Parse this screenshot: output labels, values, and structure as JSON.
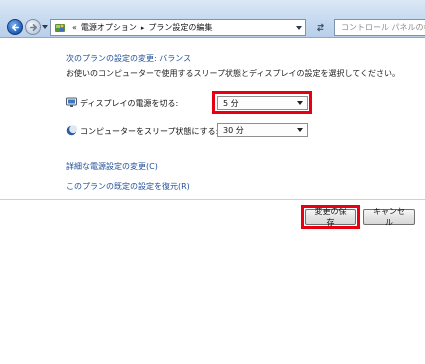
{
  "nav": {
    "breadcrumb_separator": "«",
    "crumbs": [
      "電源オプション",
      "プラン設定の編集"
    ],
    "crumb_arrow": "▸",
    "search_placeholder": "コントロール パネルの検索"
  },
  "content": {
    "heading": "次のプランの設定の変更: バランス",
    "description": "お使いのコンピューターで使用するスリープ状態とディスプレイの設定を選択してください。",
    "display_off": {
      "label": "ディスプレイの電源を切る:",
      "value": "5 分",
      "icon": "monitor-icon"
    },
    "sleep": {
      "label": "コンピューターをスリープ状態にする:",
      "value": "30 分",
      "icon": "moon-icon"
    },
    "links": {
      "advanced": "詳細な電源設定の変更(C)",
      "restore": "このプランの既定の設定を復元(R)"
    }
  },
  "buttons": {
    "save": "変更の保存",
    "cancel": "キャンセル"
  },
  "colors": {
    "highlight": "#e60012",
    "link": "#1f4e99",
    "topbar": "#c6d9ef"
  }
}
